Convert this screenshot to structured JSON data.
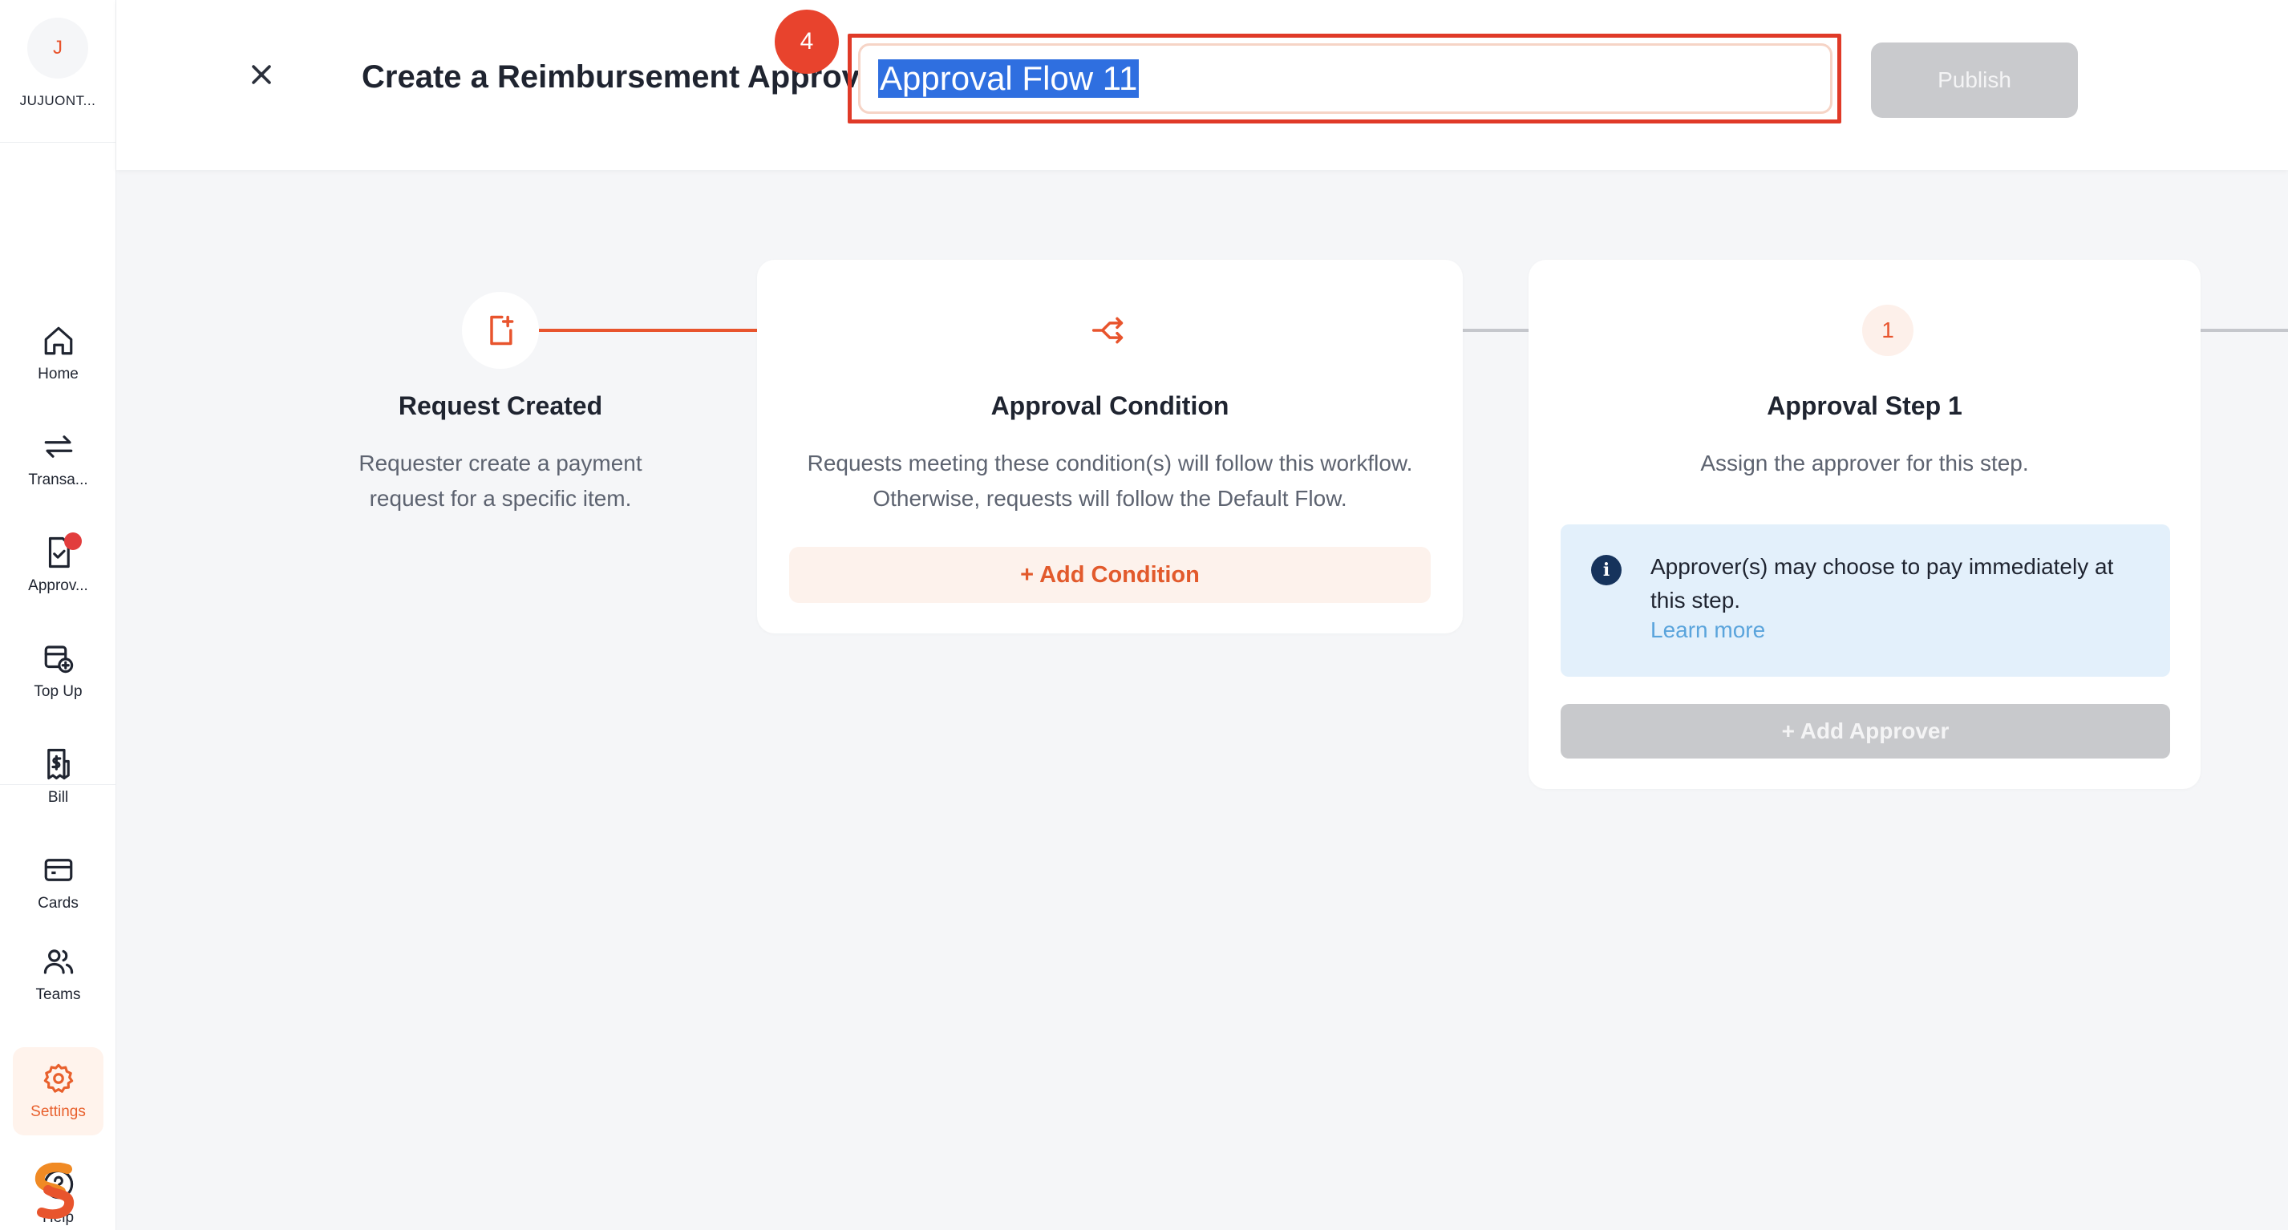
{
  "sidebar": {
    "company_initial": "J",
    "company_name": "JUJUONT...",
    "items": [
      {
        "label": "Home",
        "icon": "home-icon"
      },
      {
        "label": "Transa...",
        "icon": "transfer-arrows-icon"
      },
      {
        "label": "Approv...",
        "icon": "approval-document-icon",
        "notification": true
      },
      {
        "label": "Top Up",
        "icon": "wallet-plus-icon"
      },
      {
        "label": "Bill",
        "icon": "bill-dollar-icon"
      },
      {
        "label": "Cards",
        "icon": "card-icon"
      },
      {
        "label": "Teams",
        "icon": "users-icon"
      },
      {
        "label": "Settings",
        "icon": "gear-icon",
        "active": true
      },
      {
        "label": "Help",
        "icon": "help-circle-icon"
      }
    ]
  },
  "header": {
    "title": "Create a Reimbursement Approval Flow",
    "step_badge": "4",
    "flow_name_value": "Approval Flow 11",
    "publish_label": "Publish"
  },
  "flow": {
    "request_created": {
      "title": "Request Created",
      "description": "Requester create a payment request for a specific item."
    },
    "approval_condition": {
      "title": "Approval Condition",
      "description": "Requests meeting these condition(s) will follow this workflow. Otherwise, requests will follow the Default Flow.",
      "add_label": "+ Add Condition"
    },
    "approval_step": {
      "number": "1",
      "title": "Approval Step 1",
      "description": "Assign the approver for this step.",
      "info_text": "Approver(s) may choose to pay immediately at this step.",
      "info_link": "Learn more",
      "add_label": "+ Add Approver"
    }
  },
  "colors": {
    "accent": "#e8542d",
    "highlight_border": "#e03a28",
    "badge": "#e8432d",
    "info_bg": "#e3f0fb",
    "link": "#5aa4dc"
  }
}
